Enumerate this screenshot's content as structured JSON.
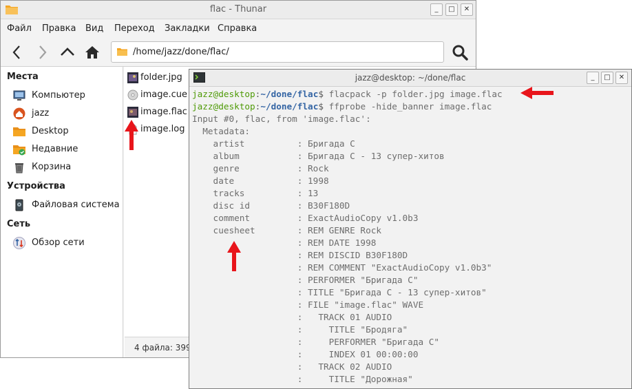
{
  "thunar": {
    "title": "flac - Thunar",
    "menu": [
      "Файл",
      "Правка",
      "Вид",
      "Переход",
      "Закладки",
      "Справка"
    ],
    "path": "/home/jazz/done/flac/",
    "sidebar": {
      "places_heading": "Места",
      "places": [
        {
          "label": "Компьютер",
          "icon": "computer-icon"
        },
        {
          "label": "jazz",
          "icon": "home-icon"
        },
        {
          "label": "Desktop",
          "icon": "folder-icon"
        },
        {
          "label": "Недавние",
          "icon": "recent-icon"
        },
        {
          "label": "Корзина",
          "icon": "trash-icon"
        }
      ],
      "devices_heading": "Устройства",
      "devices": [
        {
          "label": "Файловая система",
          "icon": "drive-icon"
        }
      ],
      "network_heading": "Сеть",
      "network": [
        {
          "label": "Обзор сети",
          "icon": "network-icon"
        }
      ]
    },
    "files": [
      "folder.jpg",
      "image.cue",
      "image.flac",
      "image.log"
    ],
    "status": "4 файла: 399"
  },
  "terminal": {
    "title": "jazz@desktop: ~/done/flac",
    "prompt_user": "jazz@desktop",
    "prompt_sep": ":",
    "prompt_path": "~/done/flac",
    "prompt_end": "$",
    "commands": [
      " flacpack -p folder.jpg image.flac",
      " ffprobe -hide_banner image.flac"
    ],
    "output": [
      "Input #0, flac, from 'image.flac':",
      "  Metadata:",
      "    artist          : Бригада С",
      "    album           : Бригада С - 13 супер-хитов",
      "    genre           : Rock",
      "    date            : 1998",
      "    tracks          : 13",
      "    disc id         : B30F180D",
      "    comment         : ExactAudioCopy v1.0b3",
      "    cuesheet        : REM GENRE Rock",
      "                    : REM DATE 1998",
      "                    : REM DISCID B30F180D",
      "                    : REM COMMENT \"ExactAudioCopy v1.0b3\"",
      "                    : PERFORMER \"Бригада С\"",
      "                    : TITLE \"Бригада С - 13 супер-хитов\"",
      "                    : FILE \"image.flac\" WAVE",
      "                    :   TRACK 01 AUDIO",
      "                    :     TITLE \"Бродяга\"",
      "                    :     PERFORMER \"Бригада С\"",
      "                    :     INDEX 01 00:00:00",
      "                    :   TRACK 02 AUDIO",
      "                    :     TITLE \"Дорожная\""
    ]
  },
  "colors": {
    "prompt_user": "#4e9a06",
    "prompt_path": "#3465a4",
    "arrow": "#e8151b",
    "folder": "#f5a623"
  }
}
